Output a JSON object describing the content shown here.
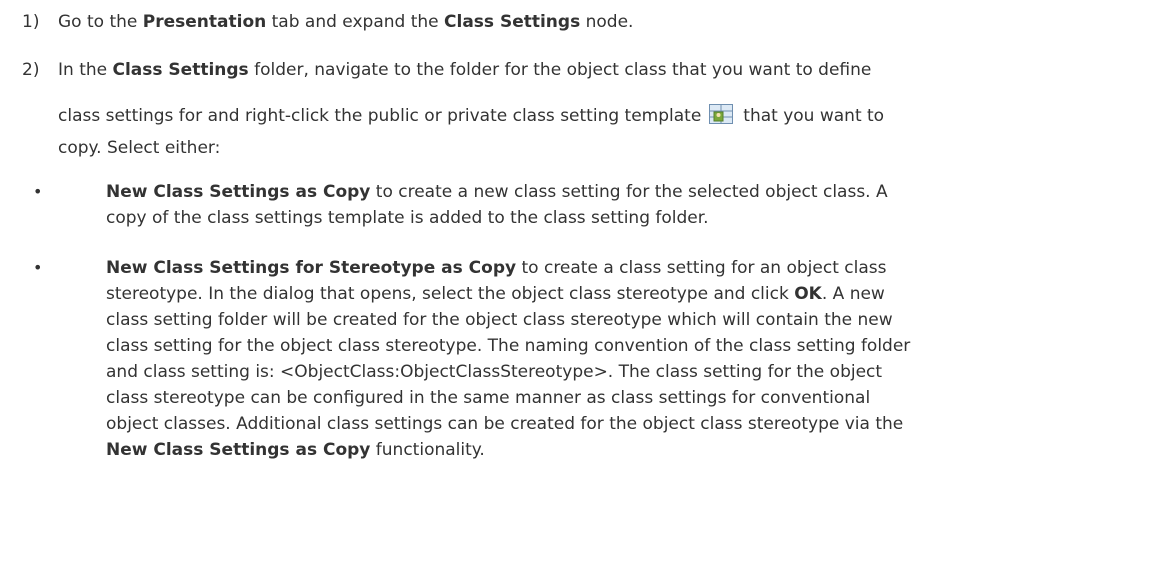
{
  "steps": [
    {
      "number": "1)",
      "parts": [
        "Go to the ",
        "Presentation",
        " tab and expand the ",
        "Class Settings",
        " node."
      ]
    },
    {
      "number": "2)",
      "line1": [
        "In the ",
        "Class Settings",
        " folder, navigate to the folder for the object class that you want to define"
      ],
      "line2_before_icon": "class settings for and right-click the public or private class setting template",
      "line2_after_icon": "that you want to",
      "line3": "copy. Select either:",
      "icon": "class-settings-template-icon"
    }
  ],
  "options": [
    {
      "bold": "New Class Settings as Copy",
      "lines": [
        " to create a new class setting for the selected object class. A",
        "copy of the class settings template is added to the class setting folder."
      ]
    },
    {
      "bold": "New Class Settings for Stereotype as Copy",
      "lines": [
        " to create a class setting for an object class",
        "stereotype. In the dialog that opens, select the object class stereotype and click ",
        "OK",
        ". A new",
        "class setting folder will be created for the object class stereotype which will contain the new",
        "class setting for the object class stereotype. The naming convention of the class setting folder",
        "and class setting is: <ObjectClass:ObjectClassStereotype>. The class setting for the object",
        "class stereotype can be configured in the same manner as class settings for conventional",
        "object classes. Additional class settings can be created for the object class stereotype via the",
        "New Class Settings as Copy",
        " functionality."
      ]
    }
  ],
  "bullet_char": "•",
  "colors": {
    "text": "#333333",
    "icon_border": "#6f8fb0",
    "icon_fill": "#dce9f5",
    "icon_accent": "#7aa83a"
  }
}
